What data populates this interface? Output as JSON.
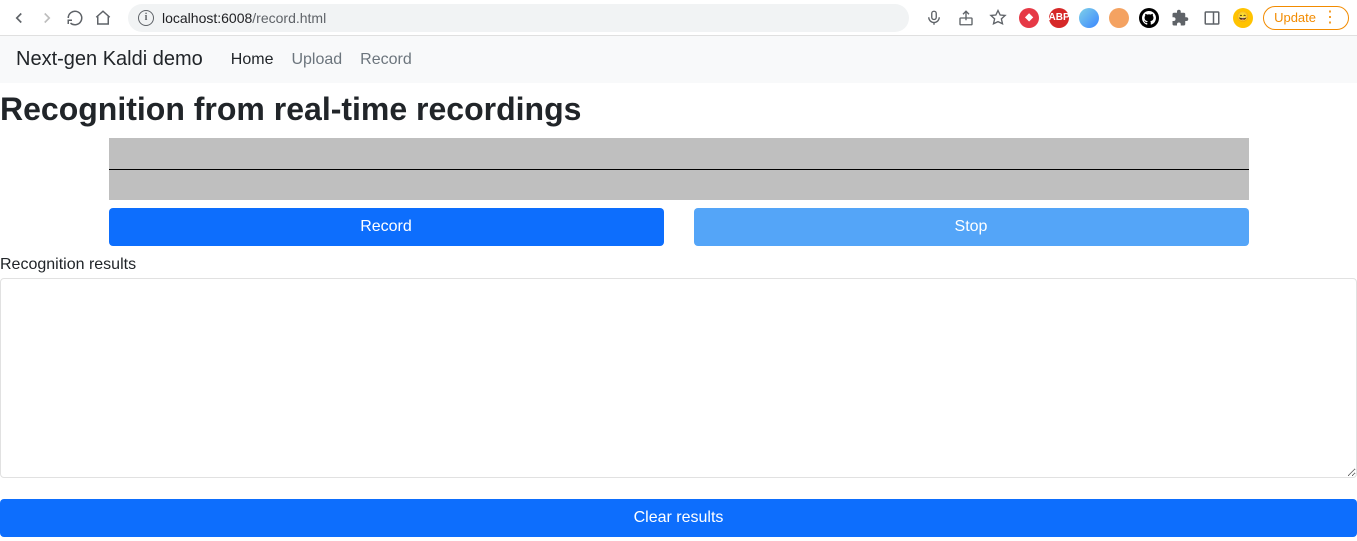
{
  "browser": {
    "url_host": "localhost:6008",
    "url_path": "/record.html",
    "update_label": "Update"
  },
  "navbar": {
    "brand": "Next-gen Kaldi demo",
    "links": [
      {
        "label": "Home",
        "active": true
      },
      {
        "label": "Upload",
        "active": false
      },
      {
        "label": "Record",
        "active": false
      }
    ]
  },
  "page": {
    "title": "Recognition from real-time recordings",
    "record_button": "Record",
    "stop_button": "Stop",
    "results_label": "Recognition results",
    "clear_button": "Clear results"
  }
}
